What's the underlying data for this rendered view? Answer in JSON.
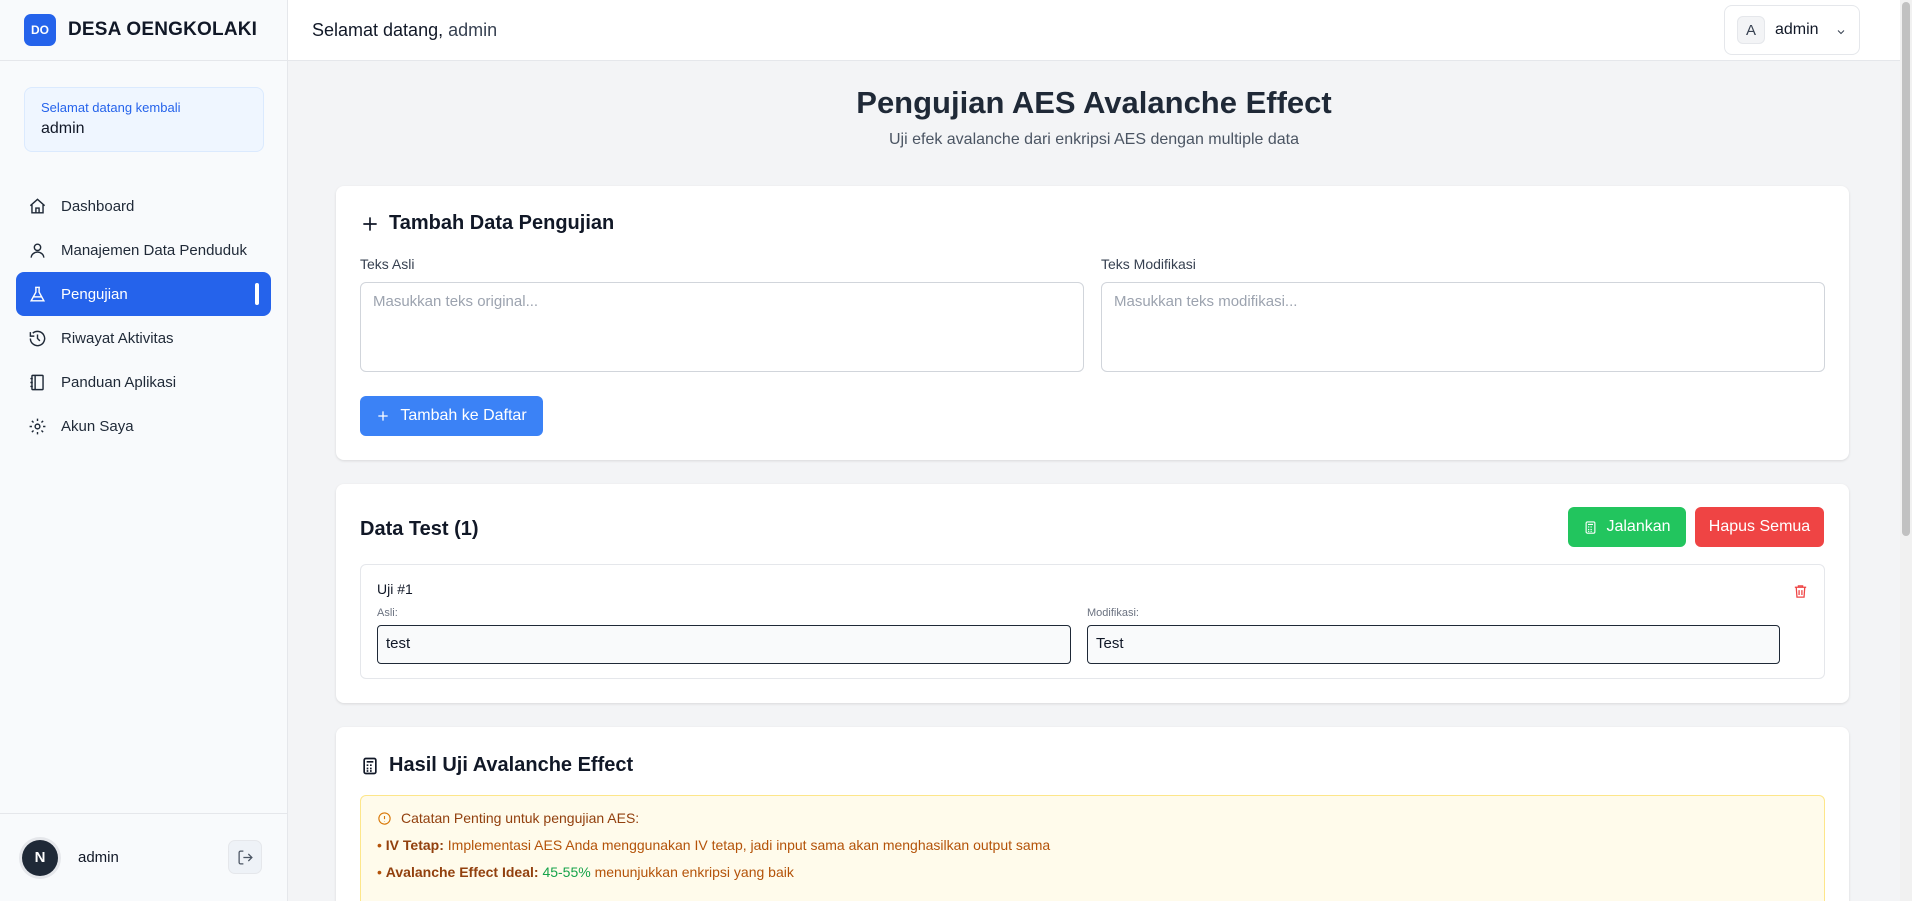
{
  "brand": {
    "logo": "DO",
    "name": "DESA OENGKOLAKI"
  },
  "welcome": {
    "small": "Selamat datang kembali",
    "name": "admin"
  },
  "nav": [
    {
      "label": "Dashboard",
      "icon": "home-icon"
    },
    {
      "label": "Manajemen Data Penduduk",
      "icon": "user-icon"
    },
    {
      "label": "Pengujian",
      "icon": "flask-icon",
      "active": true
    },
    {
      "label": "Riwayat Aktivitas",
      "icon": "history-icon"
    },
    {
      "label": "Panduan Aplikasi",
      "icon": "book-icon"
    },
    {
      "label": "Akun Saya",
      "icon": "gear-icon"
    }
  ],
  "footer": {
    "avatar": "N",
    "name": "admin"
  },
  "header": {
    "greeting": "Selamat datang,",
    "user": "admin",
    "menu_avatar": "A",
    "menu_name": "admin"
  },
  "page": {
    "title": "Pengujian AES Avalanche Effect",
    "subtitle": "Uji efek avalanche dari enkripsi AES dengan multiple data"
  },
  "add_form": {
    "title": "Tambah Data Pengujian",
    "original_label": "Teks Asli",
    "original_placeholder": "Masukkan teks original...",
    "modified_label": "Teks Modifikasi",
    "modified_placeholder": "Masukkan teks modifikasi...",
    "add_button": "Tambah ke Daftar"
  },
  "data_test": {
    "title": "Data Test (1)",
    "run_button": "Jalankan",
    "clear_button": "Hapus Semua",
    "items": [
      {
        "name": "Uji #1",
        "original_label": "Asli:",
        "original": "test",
        "modified_label": "Modifikasi:",
        "modified": "Test"
      }
    ]
  },
  "results": {
    "title": "Hasil Uji Avalanche Effect",
    "note_head": "Catatan Penting untuk pengujian AES:",
    "note_lines": [
      {
        "bullet": "• ",
        "bold": "IV Tetap:",
        "text": " Implementasi AES Anda menggunakan IV tetap, jadi input sama akan menghasilkan output sama"
      },
      {
        "bullet": "• ",
        "bold": "Avalanche Effect Ideal:",
        "highlight": " 45-55%",
        "text": " menunjukkan enkripsi yang baik"
      }
    ]
  },
  "colors": {
    "primary": "#2563eb",
    "success": "#22c55e",
    "danger": "#ef4444",
    "warning_bg": "#fffbeb"
  }
}
